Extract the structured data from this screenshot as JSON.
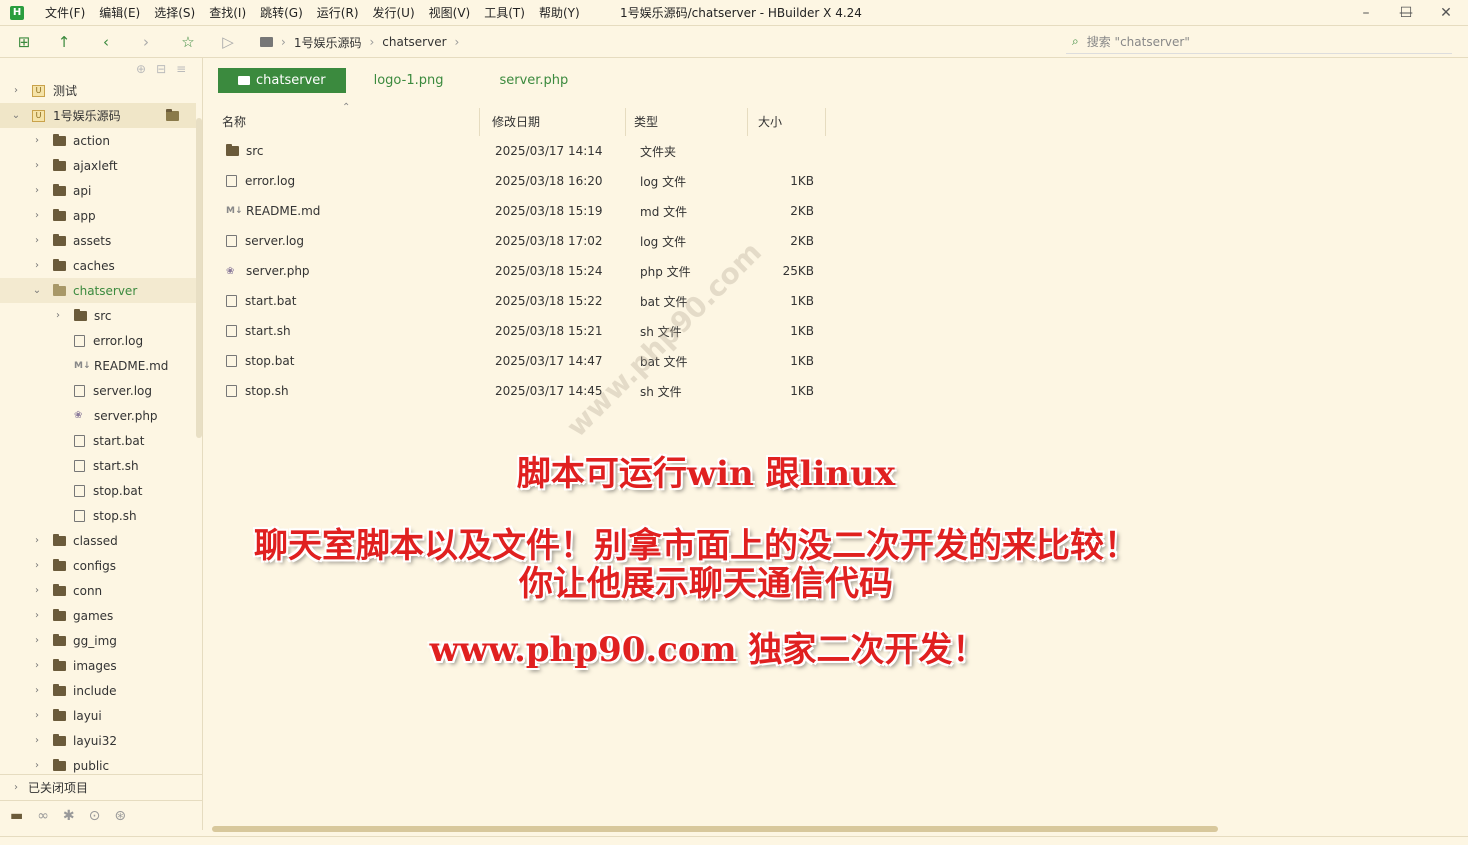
{
  "app": {
    "logo": "H",
    "window_title": "1号娱乐源码/chatserver - HBuilder X 4.24",
    "menu": [
      "文件(F)",
      "编辑(E)",
      "选择(S)",
      "查找(I)",
      "跳转(G)",
      "运行(R)",
      "发行(U)",
      "视图(V)",
      "工具(T)",
      "帮助(Y)"
    ]
  },
  "toolbar": {
    "breadcrumb": [
      "1号娱乐源码",
      "chatserver"
    ],
    "search_placeholder": "搜索 \"chatserver\""
  },
  "sidebar": {
    "items": [
      {
        "label": "测试",
        "level": 0,
        "kind": "project",
        "expanded": false
      },
      {
        "label": "1号娱乐源码",
        "level": 0,
        "kind": "project",
        "expanded": true
      },
      {
        "label": "action",
        "level": 1,
        "kind": "folder"
      },
      {
        "label": "ajaxleft",
        "level": 1,
        "kind": "folder"
      },
      {
        "label": "api",
        "level": 1,
        "kind": "folder"
      },
      {
        "label": "app",
        "level": 1,
        "kind": "folder"
      },
      {
        "label": "assets",
        "level": 1,
        "kind": "folder"
      },
      {
        "label": "caches",
        "level": 1,
        "kind": "folder"
      },
      {
        "label": "chatserver",
        "level": 1,
        "kind": "folder-open"
      },
      {
        "label": "src",
        "level": 2,
        "kind": "folder"
      },
      {
        "label": "error.log",
        "level": 2,
        "kind": "file"
      },
      {
        "label": "README.md",
        "level": 2,
        "kind": "md"
      },
      {
        "label": "server.log",
        "level": 2,
        "kind": "file"
      },
      {
        "label": "server.php",
        "level": 2,
        "kind": "php"
      },
      {
        "label": "start.bat",
        "level": 2,
        "kind": "file"
      },
      {
        "label": "start.sh",
        "level": 2,
        "kind": "file"
      },
      {
        "label": "stop.bat",
        "level": 2,
        "kind": "file"
      },
      {
        "label": "stop.sh",
        "level": 2,
        "kind": "file"
      },
      {
        "label": "classed",
        "level": 1,
        "kind": "folder"
      },
      {
        "label": "configs",
        "level": 1,
        "kind": "folder"
      },
      {
        "label": "conn",
        "level": 1,
        "kind": "folder"
      },
      {
        "label": "games",
        "level": 1,
        "kind": "folder"
      },
      {
        "label": "gg_img",
        "level": 1,
        "kind": "folder"
      },
      {
        "label": "images",
        "level": 1,
        "kind": "folder"
      },
      {
        "label": "include",
        "level": 1,
        "kind": "folder"
      },
      {
        "label": "layui",
        "level": 1,
        "kind": "folder"
      },
      {
        "label": "layui32",
        "level": 1,
        "kind": "folder"
      },
      {
        "label": "public",
        "level": 1,
        "kind": "folder"
      }
    ],
    "closed_projects": "已关闭项目"
  },
  "tabs": [
    "chatserver",
    "logo-1.png",
    "server.php"
  ],
  "file_table": {
    "headers": [
      "名称",
      "修改日期",
      "类型",
      "大小"
    ],
    "rows": [
      {
        "name": "src",
        "date": "2025/03/17 14:14",
        "type": "文件夹",
        "size": "",
        "kind": "folder"
      },
      {
        "name": "error.log",
        "date": "2025/03/18 16:20",
        "type": "log 文件",
        "size": "1KB",
        "kind": "file"
      },
      {
        "name": "README.md",
        "date": "2025/03/18 15:19",
        "type": "md 文件",
        "size": "2KB",
        "kind": "md"
      },
      {
        "name": "server.log",
        "date": "2025/03/18 17:02",
        "type": "log 文件",
        "size": "2KB",
        "kind": "file"
      },
      {
        "name": "server.php",
        "date": "2025/03/18 15:24",
        "type": "php 文件",
        "size": "25KB",
        "kind": "php"
      },
      {
        "name": "start.bat",
        "date": "2025/03/18 15:22",
        "type": "bat 文件",
        "size": "1KB",
        "kind": "file"
      },
      {
        "name": "start.sh",
        "date": "2025/03/18 15:21",
        "type": "sh 文件",
        "size": "1KB",
        "kind": "file"
      },
      {
        "name": "stop.bat",
        "date": "2025/03/17 14:47",
        "type": "bat 文件",
        "size": "1KB",
        "kind": "file"
      },
      {
        "name": "stop.sh",
        "date": "2025/03/17 14:45",
        "type": "sh 文件",
        "size": "1KB",
        "kind": "file"
      }
    ]
  },
  "overlay": {
    "line1": "脚本可运行win 跟linux",
    "line2": "聊天室脚本以及文件！别拿市面上的没二次开发的来比较！",
    "line3": "你让他展示聊天通信代码",
    "line4": "www.php90.com 独家二次开发！"
  },
  "watermark": "www.php90.com",
  "colors": {
    "accent": "#3b8a3e",
    "background": "#fdf6e3",
    "overlay_text": "#e02020"
  }
}
